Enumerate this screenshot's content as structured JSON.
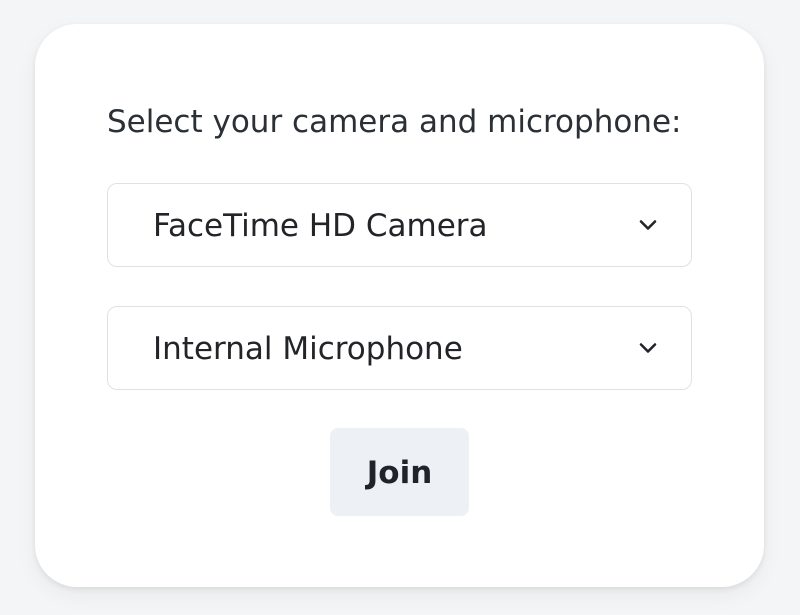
{
  "dialog": {
    "prompt": "Select your camera and microphone:",
    "camera_select": {
      "selected": "FaceTime HD Camera",
      "icon": "chevron-down-icon"
    },
    "microphone_select": {
      "selected": "Internal Microphone",
      "icon": "chevron-down-icon"
    },
    "join_label": "Join"
  },
  "colors": {
    "background": "#f4f5f7",
    "card": "#ffffff",
    "border": "#dfe1e6",
    "join_button": "#edf0f5",
    "text": "#222428"
  }
}
